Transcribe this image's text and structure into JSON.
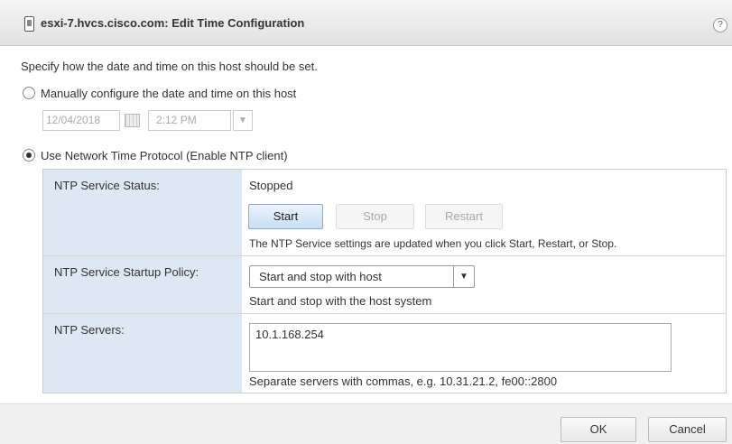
{
  "dialog": {
    "title": "esxi-7.hvcs.cisco.com: Edit Time Configuration",
    "help": "?"
  },
  "instructions": "Specify how the date and time on this host should be set.",
  "manual": {
    "label": "Manually configure the date and time on this host",
    "selected": false,
    "date_value": "12/04/2018",
    "time_value": "2:12 PM"
  },
  "ntp": {
    "label": "Use Network Time Protocol (Enable NTP client)",
    "selected": true,
    "status_label": "NTP Service Status:",
    "status_value": "Stopped",
    "start_label": "Start",
    "stop_label": "Stop",
    "restart_label": "Restart",
    "service_hint": "The NTP Service settings are updated when you click Start, Restart, or Stop.",
    "policy_label": "NTP Service Startup Policy:",
    "policy_value": "Start and stop with host",
    "policy_hint": "Start and stop with the host system",
    "servers_label": "NTP Servers:",
    "servers_value": "10.1.168.254",
    "servers_hint": "Separate servers with commas, e.g. 10.31.21.2, fe00::2800"
  },
  "footer": {
    "ok_label": "OK",
    "cancel_label": "Cancel"
  }
}
